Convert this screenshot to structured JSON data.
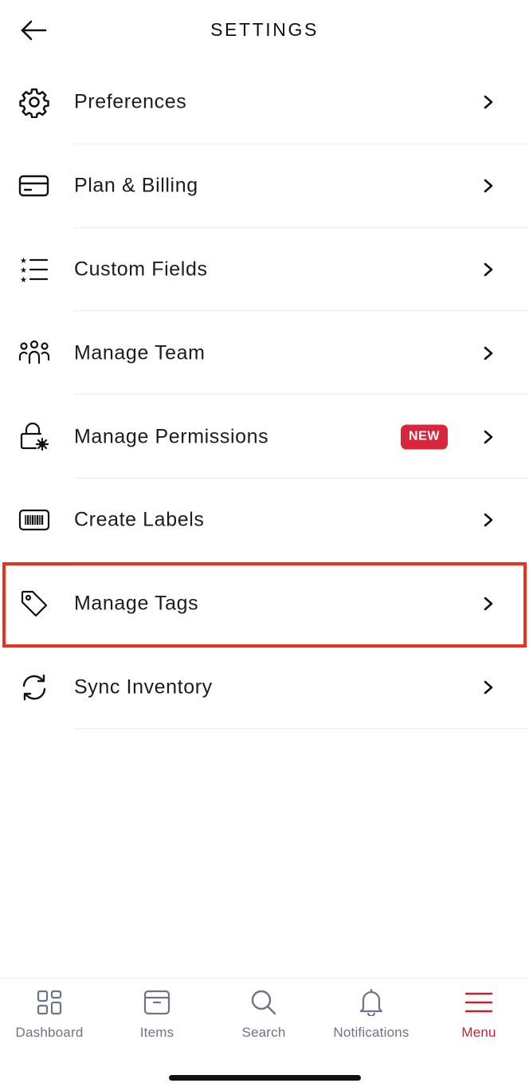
{
  "header": {
    "title": "SETTINGS"
  },
  "settings": {
    "items": [
      {
        "label": "Preferences",
        "icon": "gear-icon"
      },
      {
        "label": "Plan & Billing",
        "icon": "credit-card-icon"
      },
      {
        "label": "Custom Fields",
        "icon": "starred-list-icon"
      },
      {
        "label": "Manage Team",
        "icon": "team-icon"
      },
      {
        "label": "Manage Permissions",
        "icon": "lock-gear-icon",
        "badge": "NEW"
      },
      {
        "label": "Create Labels",
        "icon": "barcode-icon"
      },
      {
        "label": "Manage Tags",
        "icon": "tag-icon",
        "highlighted": true
      },
      {
        "label": "Sync Inventory",
        "icon": "sync-icon"
      }
    ]
  },
  "tabbar": {
    "tabs": [
      {
        "label": "Dashboard",
        "icon": "dashboard-grid-icon"
      },
      {
        "label": "Items",
        "icon": "box-icon"
      },
      {
        "label": "Search",
        "icon": "search-icon"
      },
      {
        "label": "Notifications",
        "icon": "bell-icon"
      },
      {
        "label": "Menu",
        "icon": "hamburger-menu-icon",
        "active": true
      }
    ]
  },
  "colors": {
    "accent": "#cc1f2f",
    "badge": "#d9263a",
    "highlight_border": "#f0301a",
    "tab_inactive": "#6f7389"
  }
}
